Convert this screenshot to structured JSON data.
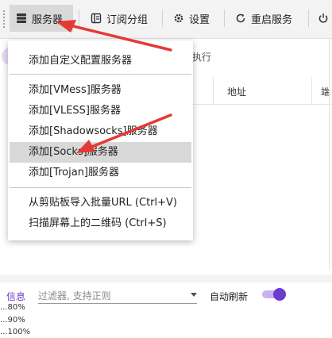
{
  "toolbar": {
    "servers_label": "服务器",
    "subscription_label": "订阅分组",
    "settings_label": "设置",
    "restart_label": "重启服务"
  },
  "background": {
    "tab_text": "车执行",
    "col_address": "地址",
    "col_port": "端"
  },
  "menu": {
    "add_custom": "添加自定义配置服务器",
    "add_vmess": "添加[VMess]服务器",
    "add_vless": "添加[VLESS]服务器",
    "add_shadowsocks": "添加[Shadowsocks]服务器",
    "add_socks": "添加[Socks]服务器",
    "add_trojan": "添加[Trojan]服务器",
    "import_clipboard": "从剪贴板导入批量URL (Ctrl+V)",
    "scan_qr": "扫描屏幕上的二维码 (Ctrl+S)"
  },
  "bottom": {
    "info_label": "信息",
    "filter_placeholder": "过滤器, 支持正则",
    "auto_refresh_label": "自动刷新",
    "auto_refresh_on": true,
    "log_lines": [
      "...80%",
      "...90%",
      "...100%"
    ]
  },
  "colors": {
    "accent": "#6c3cd0",
    "annotation": "#e53935"
  }
}
